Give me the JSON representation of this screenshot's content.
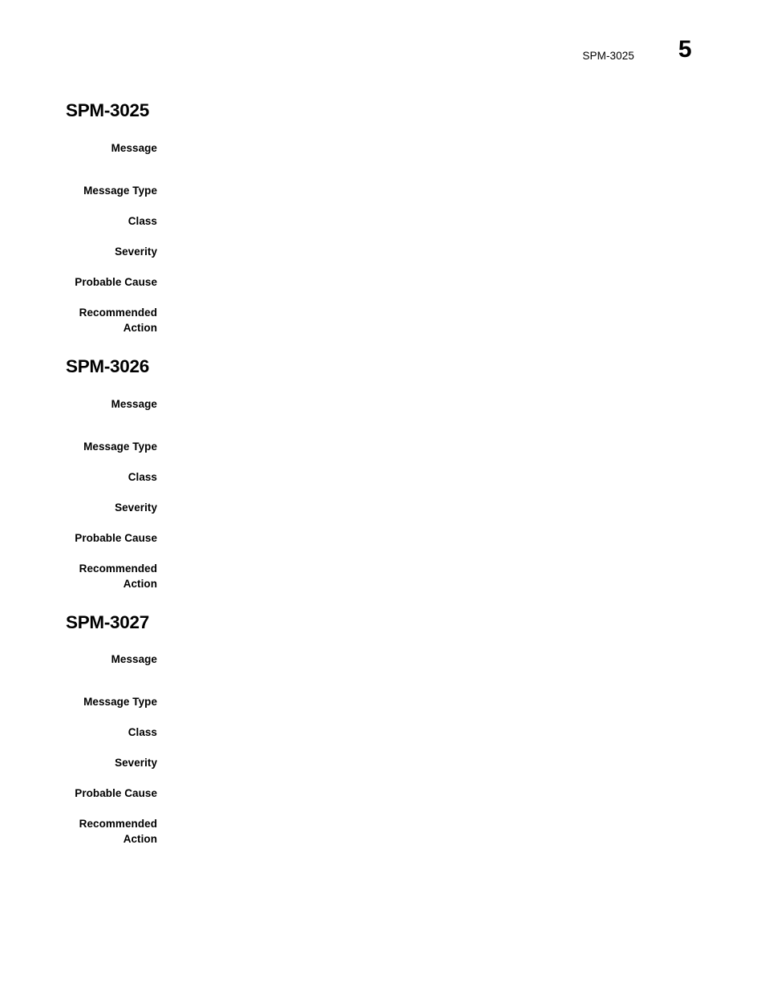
{
  "header": {
    "running_title": "SPM-3025",
    "page_number": "5"
  },
  "sections": [
    {
      "heading": "SPM-3025",
      "rows": [
        {
          "label": "Message",
          "value": ""
        },
        {
          "label": "Message Type",
          "value": ""
        },
        {
          "label": "Class",
          "value": ""
        },
        {
          "label": "Severity",
          "value": ""
        },
        {
          "label": "Probable Cause",
          "value": ""
        },
        {
          "label": "Recommended\nAction",
          "value": ""
        }
      ]
    },
    {
      "heading": "SPM-3026",
      "rows": [
        {
          "label": "Message",
          "value": ""
        },
        {
          "label": "Message Type",
          "value": ""
        },
        {
          "label": "Class",
          "value": ""
        },
        {
          "label": "Severity",
          "value": ""
        },
        {
          "label": "Probable Cause",
          "value": ""
        },
        {
          "label": "Recommended\nAction",
          "value": ""
        }
      ]
    },
    {
      "heading": "SPM-3027",
      "rows": [
        {
          "label": "Message",
          "value": ""
        },
        {
          "label": "Message Type",
          "value": ""
        },
        {
          "label": "Class",
          "value": ""
        },
        {
          "label": "Severity",
          "value": ""
        },
        {
          "label": "Probable Cause",
          "value": ""
        },
        {
          "label": "Recommended\nAction",
          "value": ""
        }
      ]
    }
  ]
}
